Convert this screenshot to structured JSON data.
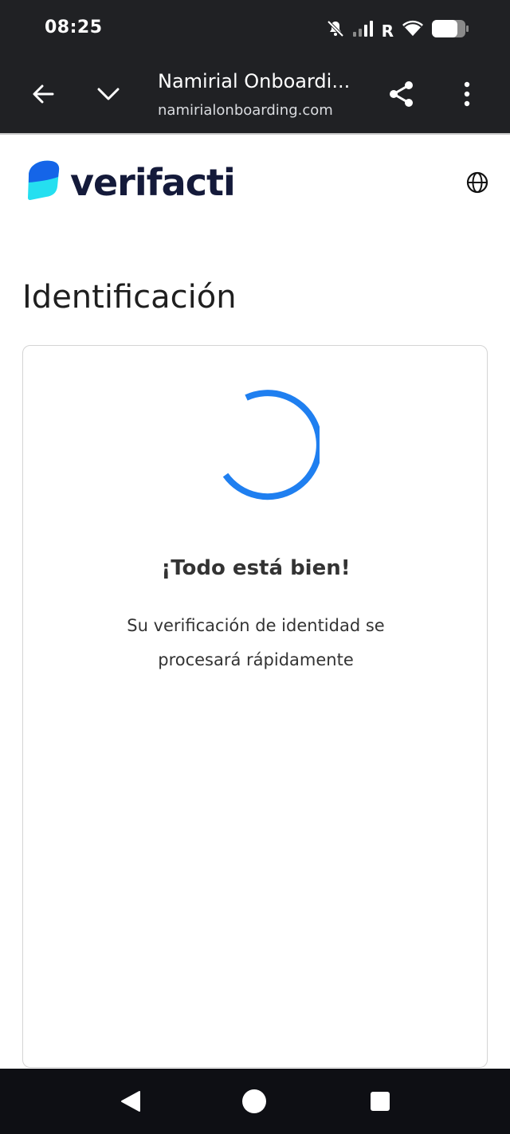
{
  "status_bar": {
    "time": "08:25",
    "network_label": "R",
    "icons": [
      "mute-icon",
      "signal-icon",
      "wifi-icon",
      "battery-icon"
    ]
  },
  "browser": {
    "tab_title": "Namirial Onboardi...",
    "url": "namirialonboarding.com",
    "icons": [
      "back-arrow-icon",
      "chevron-down-icon",
      "share-icon",
      "more-vert-icon"
    ]
  },
  "brand": {
    "name": "verifacti",
    "colors": {
      "logo_dark": "#1565e8",
      "logo_light": "#25dff0",
      "text": "#141a3a"
    }
  },
  "page": {
    "title": "Identificación",
    "language_icon": "globe-icon"
  },
  "status_card": {
    "heading": "¡Todo está bien!",
    "message": "Su verificación de identidad se procesará rápidamente",
    "spinner_color": "#1f7ff0"
  },
  "nav_bar": {
    "icons": [
      "back-triangle-icon",
      "home-circle-icon",
      "recents-square-icon"
    ]
  }
}
